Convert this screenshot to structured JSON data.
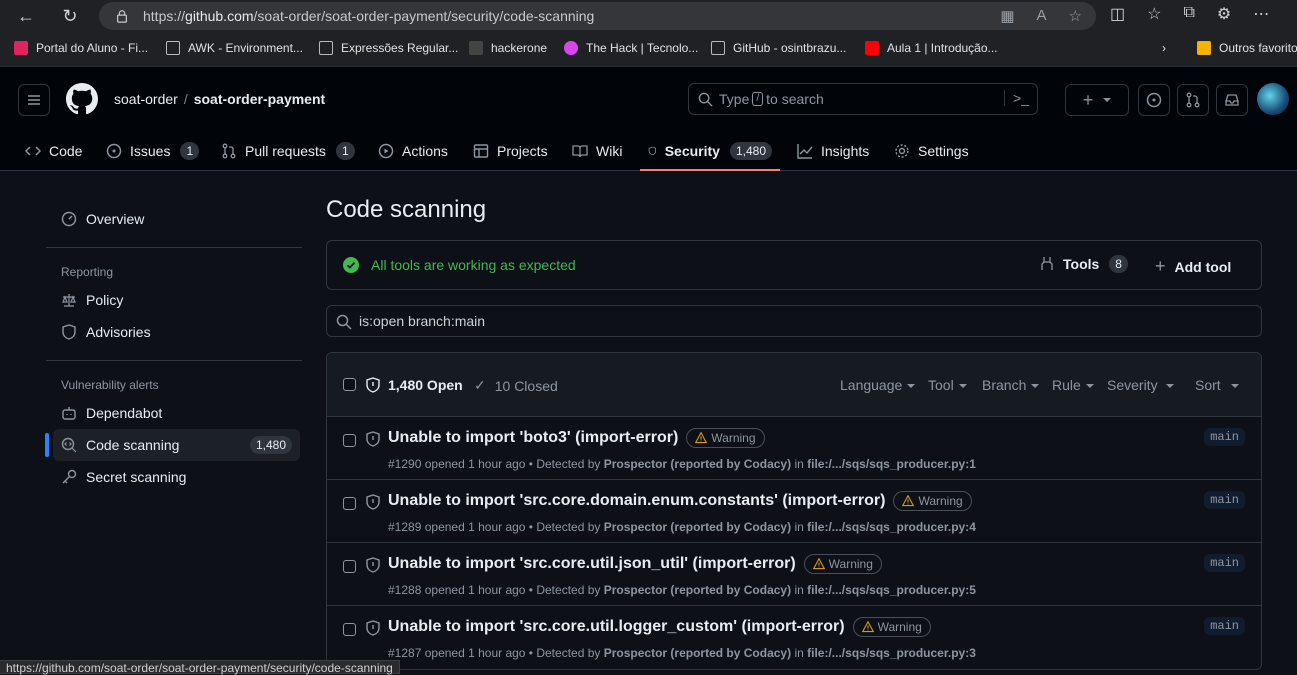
{
  "browser": {
    "url_prefix": "https://",
    "url_host": "github.com",
    "url_path": "/soat-order/soat-order-payment/security/code-scanning",
    "status_url": "https://github.com/soat-order/soat-order-payment/security/code-scanning"
  },
  "bookmarks": [
    {
      "label": "Portal do Aluno - Fi...",
      "color": "#e0245e"
    },
    {
      "label": "AWK - Environment...",
      "color": ""
    },
    {
      "label": "Expressões Regular...",
      "color": ""
    },
    {
      "label": "hackerone",
      "color": "#444"
    },
    {
      "label": "The Hack | Tecnolo...",
      "color": "#d946ef"
    },
    {
      "label": "GitHub - osintbrazu...",
      "color": ""
    },
    {
      "label": "Aula 1 | Introdução...",
      "color": "#ff0000"
    },
    {
      "label": "Outros favoritos",
      "color": "#f4b400"
    }
  ],
  "header": {
    "owner": "soat-order",
    "separator": "/",
    "repo": "soat-order-payment",
    "search_pre": "Type",
    "search_key": "/",
    "search_post": "to search"
  },
  "tabs": {
    "code": "Code",
    "issues": "Issues",
    "issues_count": "1",
    "pulls": "Pull requests",
    "pulls_count": "1",
    "actions": "Actions",
    "projects": "Projects",
    "wiki": "Wiki",
    "security": "Security",
    "security_count": "1,480",
    "insights": "Insights",
    "settings": "Settings"
  },
  "sidebar": {
    "overview": "Overview",
    "reporting_head": "Reporting",
    "policy": "Policy",
    "advisories": "Advisories",
    "vuln_head": "Vulnerability alerts",
    "dependabot": "Dependabot",
    "code_scanning": "Code scanning",
    "code_scanning_count": "1,480",
    "secret_scanning": "Secret scanning"
  },
  "main": {
    "title": "Code scanning",
    "status": "All tools are working as expected",
    "tools_label": "Tools",
    "tools_count": "8",
    "add_tool": "Add tool",
    "filter": "is:open branch:main",
    "open_label": "1,480 Open",
    "closed_label": "10 Closed",
    "filters": [
      "Language",
      "Tool",
      "Branch",
      "Rule",
      "Severity",
      "Sort"
    ]
  },
  "alerts": [
    {
      "title": "Unable to import 'boto3' (import-error)",
      "badge": "Warning",
      "num": "#1290",
      "opened": "opened 1 hour ago • Detected by",
      "tool": "Prospector (reported by Codacy)",
      "in": "in",
      "file": "file:/.../sqs/sqs_producer.py:1",
      "branch": "main"
    },
    {
      "title": "Unable to import 'src.core.domain.enum.constants' (import-error)",
      "badge": "Warning",
      "num": "#1289",
      "opened": "opened 1 hour ago • Detected by",
      "tool": "Prospector (reported by Codacy)",
      "in": "in",
      "file": "file:/.../sqs/sqs_producer.py:4",
      "branch": "main"
    },
    {
      "title": "Unable to import 'src.core.util.json_util' (import-error)",
      "badge": "Warning",
      "num": "#1288",
      "opened": "opened 1 hour ago • Detected by",
      "tool": "Prospector (reported by Codacy)",
      "in": "in",
      "file": "file:/.../sqs/sqs_producer.py:5",
      "branch": "main"
    },
    {
      "title": "Unable to import 'src.core.util.logger_custom' (import-error)",
      "badge": "Warning",
      "num": "#1287",
      "opened": "opened 1 hour ago • Detected by",
      "tool": "Prospector (reported by Codacy)",
      "in": "in",
      "file": "file:/.../sqs/sqs_producer.py:3",
      "branch": "main"
    }
  ]
}
